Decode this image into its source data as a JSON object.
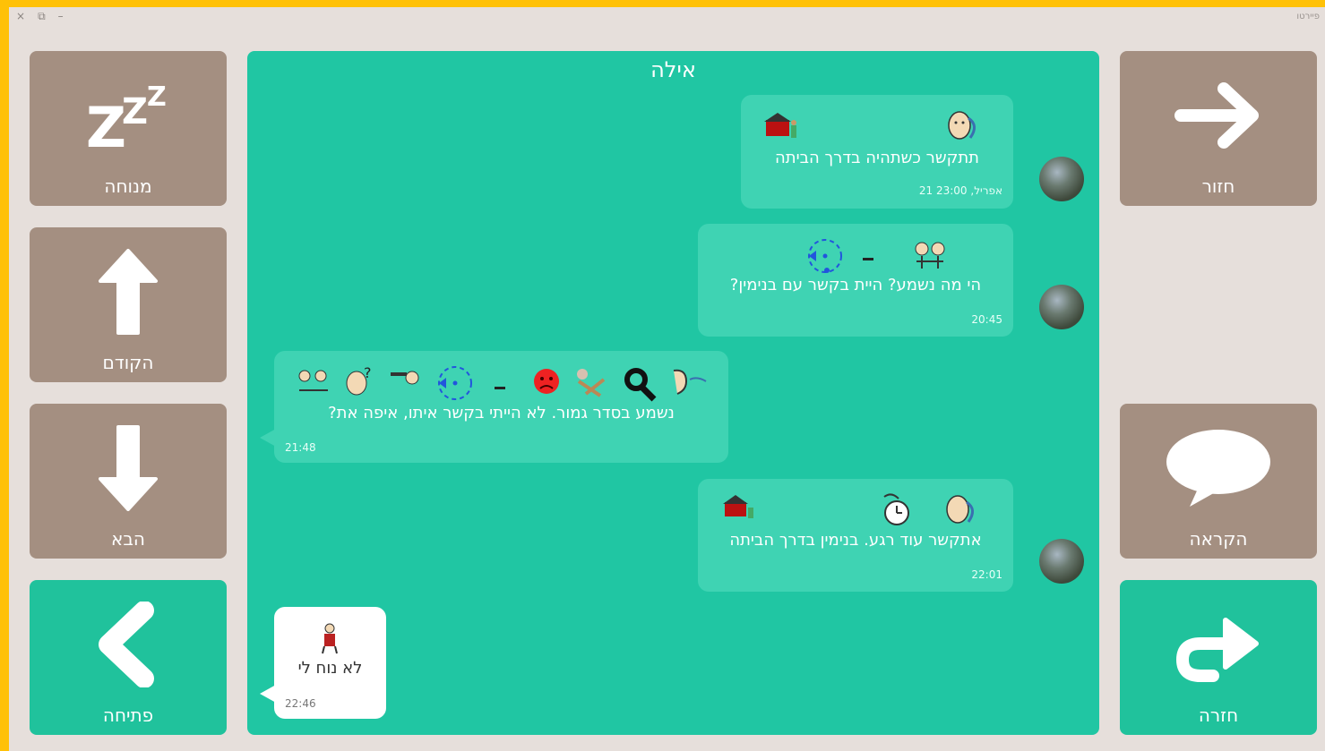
{
  "window": {
    "title": "פיירטו",
    "controls": [
      "×",
      "⧉",
      "–"
    ]
  },
  "left_tiles": [
    {
      "label": "מנוחה",
      "icon": "sleep-zzz-icon"
    },
    {
      "label": "הקודם",
      "icon": "arrow-up-icon"
    },
    {
      "label": "הבא",
      "icon": "arrow-down-icon"
    },
    {
      "label": "פתיחה",
      "icon": "chevron-left-icon"
    }
  ],
  "right_tiles": [
    {
      "label": "חזור",
      "icon": "arrow-right-icon"
    },
    {
      "label": "הקראה",
      "icon": "speech-bubble-icon"
    },
    {
      "label": "חזרה",
      "icon": "redo-arrow-icon"
    }
  ],
  "chat": {
    "title": "אילה",
    "messages": [
      {
        "text": "תתקשר כשתהיה בדרך הביתה",
        "time": "21 אפריל, 23:00"
      },
      {
        "text": "הי מה נשמע? היית בקשר עם בנימין?",
        "time": "20:45"
      },
      {
        "text": "נשמע בסדר גמור.  לא  הייתי בקשר איתו, איפה  את?",
        "time": "21:48"
      },
      {
        "text": "אתקשר עוד רגע. בנימין בדרך הביתה",
        "time": "22:01"
      },
      {
        "text": "לא נוח לי",
        "time": "22:46"
      }
    ]
  },
  "colors": {
    "accent": "#20c6a3",
    "tile": "#a48f81",
    "frame": "#ffc107"
  }
}
